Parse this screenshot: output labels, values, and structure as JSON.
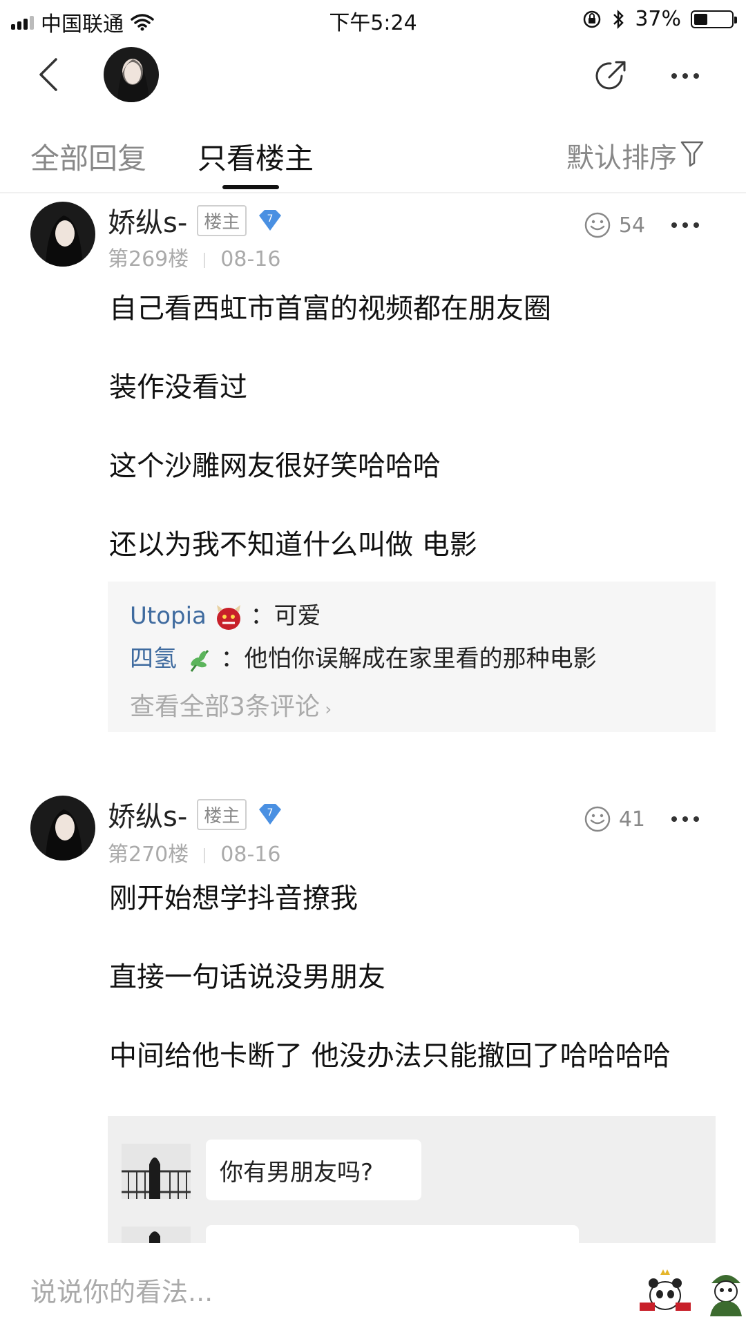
{
  "status_bar": {
    "carrier": "中国联通",
    "time": "下午5:24",
    "battery": "37%",
    "battery_level": 0.37
  },
  "tabs": {
    "all": "全部回复",
    "op_only": "只看楼主",
    "sort": "默认排序"
  },
  "posts": [
    {
      "author": "娇纵s-",
      "badge": "楼主",
      "level": "7",
      "floor": "第269楼",
      "date": "08-16",
      "likes": "54",
      "lines": [
        "自己看西虹市首富的视频都在朋友圈",
        "装作没看过",
        "这个沙雕网友很好笑哈哈哈",
        "还以为我不知道什么叫做 电影"
      ],
      "comments": [
        {
          "user": "Utopia",
          "text": "：可爱"
        },
        {
          "user": "四氢",
          "text": "：他怕你误解成在家里看的那种电影"
        }
      ],
      "view_all": "查看全部3条评论"
    },
    {
      "author": "娇纵s-",
      "badge": "楼主",
      "level": "7",
      "floor": "第270楼",
      "date": "08-16",
      "likes": "41",
      "lines": [
        "刚开始想学抖音撩我",
        "直接一句话说没男朋友",
        "中间给他卡断了 他没办法只能撤回了哈哈哈哈"
      ],
      "image_chat": [
        "你有男朋友吗?"
      ]
    }
  ],
  "input": {
    "placeholder": "说说你的看法..."
  },
  "colors": {
    "username_link": "#3f6b9f",
    "muted": "#aaaaaa",
    "level_gem": "#4a90e2"
  }
}
